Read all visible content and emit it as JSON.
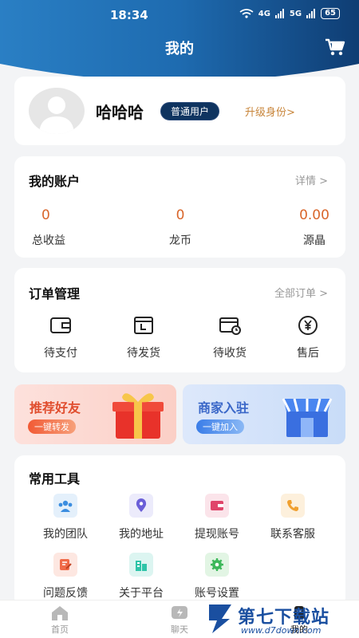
{
  "status_bar": {
    "time": "18:34",
    "battery": "65",
    "signal_1": "4G",
    "signal_2": "5G"
  },
  "header": {
    "title": "我的"
  },
  "profile": {
    "name": "哈哈哈",
    "badge": "普通用户",
    "upgrade": "升级身份>"
  },
  "account": {
    "title": "我的账户",
    "link": "详情 >",
    "items": [
      {
        "value": "0",
        "label": "总收益"
      },
      {
        "value": "0",
        "label": "龙币"
      },
      {
        "value": "0.00",
        "label": "源晶"
      }
    ]
  },
  "orders": {
    "title": "订单管理",
    "link": "全部订单 >",
    "items": [
      {
        "label": "待支付",
        "icon": "wallet-icon"
      },
      {
        "label": "待发货",
        "icon": "package-icon"
      },
      {
        "label": "待收货",
        "icon": "delivery-icon"
      },
      {
        "label": "售后",
        "icon": "yen-icon"
      }
    ]
  },
  "banners": [
    {
      "title": "推荐好友",
      "button": "一键转发"
    },
    {
      "title": "商家入驻",
      "button": "一键加入"
    }
  ],
  "tools": {
    "title": "常用工具",
    "items": [
      {
        "label": "我的团队",
        "icon": "team-icon"
      },
      {
        "label": "我的地址",
        "icon": "location-icon"
      },
      {
        "label": "提现账号",
        "icon": "wallet-icon"
      },
      {
        "label": "联系客服",
        "icon": "phone-icon"
      },
      {
        "label": "问题反馈",
        "icon": "feedback-icon"
      },
      {
        "label": "关于平台",
        "icon": "building-icon"
      },
      {
        "label": "账号设置",
        "icon": "settings-icon"
      }
    ]
  },
  "bottom_nav": [
    {
      "label": "首页",
      "icon": "home-icon"
    },
    {
      "label": "聊天",
      "icon": "chat-icon"
    },
    {
      "label": "我的",
      "icon": "profile-icon"
    }
  ],
  "watermark": {
    "title": "第七下载站",
    "url": "www.d7down.com"
  },
  "colors": {
    "header_blue": "#1d6fb8",
    "accent_orange": "#d9662b",
    "badge_navy": "#0f3460"
  }
}
